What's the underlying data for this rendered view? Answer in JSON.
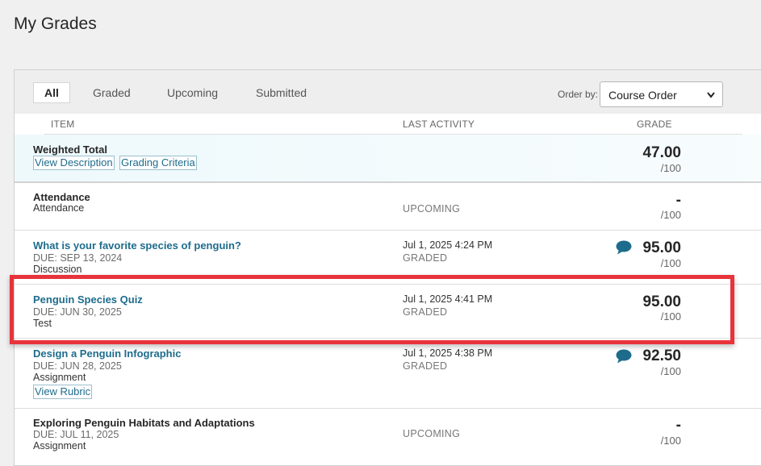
{
  "page": {
    "title": "My Grades"
  },
  "filters": [
    {
      "label": "All",
      "active": true
    },
    {
      "label": "Graded"
    },
    {
      "label": "Upcoming"
    },
    {
      "label": "Submitted"
    }
  ],
  "order": {
    "label": "Order by:",
    "selected": "Course Order"
  },
  "columns": {
    "item": "ITEM",
    "last_activity": "LAST ACTIVITY",
    "grade": "GRADE"
  },
  "rows": [
    {
      "title": "Weighted Total",
      "links": [
        "View Description",
        "Grading Criteria"
      ],
      "grade": "47.00",
      "max": "/100"
    },
    {
      "title": "Attendance",
      "type": "Attendance",
      "status": "UPCOMING",
      "grade": "-",
      "max": "/100"
    },
    {
      "title": "What is your favorite species of penguin?",
      "due": "DUE: SEP 13, 2024",
      "type": "Discussion",
      "activity_date": "Jul 1, 2025 4:24 PM",
      "status": "GRADED",
      "grade": "95.00",
      "max": "/100",
      "has_comment": true
    },
    {
      "title": "Penguin Species Quiz",
      "due": "DUE: JUN 30, 2025",
      "type": "Test",
      "activity_date": "Jul 1, 2025 4:41 PM",
      "status": "GRADED",
      "grade": "95.00",
      "max": "/100"
    },
    {
      "title": "Design a Penguin Infographic",
      "due": "DUE: JUN 28, 2025",
      "type": "Assignment",
      "activity_date": "Jul 1, 2025 4:38 PM",
      "status": "GRADED",
      "grade": "92.50",
      "max": "/100",
      "has_comment": true,
      "links": [
        "View Rubric"
      ]
    },
    {
      "title": "Exploring Penguin Habitats and Adaptations",
      "due": "DUE: JUL 11, 2025",
      "type": "Assignment",
      "status": "UPCOMING",
      "grade": "-",
      "max": "/100"
    }
  ],
  "colors": {
    "link": "#1d6c8c",
    "highlight": "#e8333b",
    "comment_icon": "#1d6c8c"
  }
}
